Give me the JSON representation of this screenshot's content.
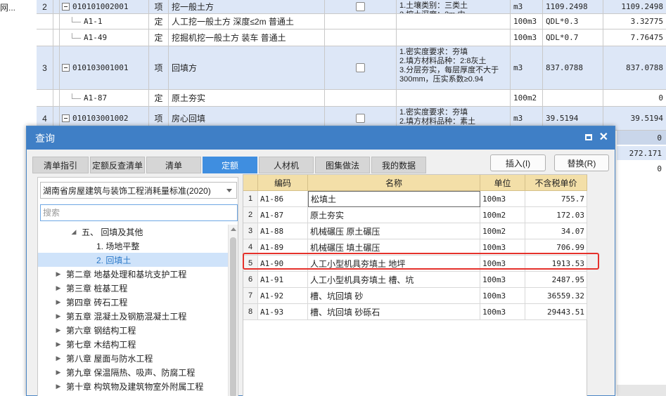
{
  "background": {
    "left_text": "网...",
    "rows": [
      {
        "idx": "2",
        "code": "010101002001",
        "type": "项",
        "name": "挖一般土方",
        "desc": "1.土壤类别：三类土\n2.挖土深度：2m 内",
        "unit": "m3",
        "expr": "1109.2498",
        "value": "1109.2498",
        "style": "blue",
        "level": "parent"
      },
      {
        "idx": "",
        "code": "A1-1",
        "type": "定",
        "name": "人工挖一般土方 深度≤2m 普通土",
        "desc": "",
        "unit": "100m3",
        "expr": "QDL*0.3",
        "value": "3.32775",
        "style": "white",
        "level": "child"
      },
      {
        "idx": "",
        "code": "A1-49",
        "type": "定",
        "name": "挖掘机挖一般土方 装车 普通土",
        "desc": "",
        "unit": "100m3",
        "expr": "QDL*0.7",
        "value": "7.76475",
        "style": "white",
        "level": "child"
      },
      {
        "idx": "3",
        "code": "010103001001",
        "type": "项",
        "name": "回填方",
        "desc": "1.密实度要求：夯填\n2.填方材料品种：2:8灰土\n3.分层夯实，每层厚度不大于300mm，压实系数≥0.94",
        "unit": "m3",
        "expr": "837.0788",
        "value": "837.0788",
        "style": "blue",
        "level": "parent"
      },
      {
        "idx": "",
        "code": "A1-87",
        "type": "定",
        "name": "原土夯实",
        "desc": "",
        "unit": "100m2",
        "expr": "",
        "value": "0",
        "style": "white",
        "level": "child"
      },
      {
        "idx": "4",
        "code": "010103001002",
        "type": "项",
        "name": "房心回填",
        "desc": "1.密实度要求：夯填\n2.填方材料品种：素土",
        "unit": "m3",
        "expr": "39.5194",
        "value": "39.5194",
        "style": "blue",
        "level": "parent"
      }
    ],
    "strip_values": [
      "0",
      "272.171",
      "0"
    ]
  },
  "dialog": {
    "title": "查询",
    "tabs": [
      "清单指引",
      "定额反查清单",
      "清单",
      "定额",
      "人材机",
      "图集做法",
      "我的数据"
    ],
    "active_tab": "定额",
    "insert_label": "插入(I)",
    "replace_label": "替换(R)",
    "standard_select": "湖南省房屋建筑与装饰工程消耗量标准(2020)",
    "search_placeholder": "搜索",
    "tree": [
      {
        "label": "五、 回填及其他",
        "indent": 46,
        "tri": "◢",
        "selected": false
      },
      {
        "label": "1. 场地平整",
        "indent": 83,
        "tri": "",
        "selected": false
      },
      {
        "label": "2. 回填土",
        "indent": 83,
        "tri": "",
        "selected": true
      },
      {
        "label": "第二章 地基处理和基坑支护工程",
        "indent": 24,
        "tri": "▶",
        "selected": false
      },
      {
        "label": "第三章 桩基工程",
        "indent": 24,
        "tri": "▶",
        "selected": false
      },
      {
        "label": "第四章 砖石工程",
        "indent": 24,
        "tri": "▶",
        "selected": false
      },
      {
        "label": "第五章 混凝土及钢筋混凝土工程",
        "indent": 24,
        "tri": "▶",
        "selected": false
      },
      {
        "label": "第六章 钢结构工程",
        "indent": 24,
        "tri": "▶",
        "selected": false
      },
      {
        "label": "第七章 木结构工程",
        "indent": 24,
        "tri": "▶",
        "selected": false
      },
      {
        "label": "第八章 屋面与防水工程",
        "indent": 24,
        "tri": "▶",
        "selected": false
      },
      {
        "label": "第九章 保温隔热、吸声、防腐工程",
        "indent": 24,
        "tri": "▶",
        "selected": false
      },
      {
        "label": "第十章 构筑物及建筑物室外附属工程",
        "indent": 24,
        "tri": "▶",
        "selected": false
      },
      {
        "label": "第十一章 楼地面工程",
        "indent": 24,
        "tri": "▶",
        "selected": false
      }
    ],
    "grid": {
      "headers": {
        "code": "编码",
        "name": "名称",
        "unit": "单位",
        "price": "不含税单价"
      },
      "rows": [
        {
          "n": "1",
          "code": "A1-86",
          "name": "松填土",
          "unit": "100m3",
          "price": "755.7"
        },
        {
          "n": "2",
          "code": "A1-87",
          "name": "原土夯实",
          "unit": "100m2",
          "price": "172.03"
        },
        {
          "n": "3",
          "code": "A1-88",
          "name": "机械碾压 原土碾压",
          "unit": "100m2",
          "price": "34.07"
        },
        {
          "n": "4",
          "code": "A1-89",
          "name": "机械碾压 填土碾压",
          "unit": "100m3",
          "price": "706.99"
        },
        {
          "n": "5",
          "code": "A1-90",
          "name": "人工小型机具夯填土 地坪",
          "unit": "100m3",
          "price": "1913.53"
        },
        {
          "n": "6",
          "code": "A1-91",
          "name": "人工小型机具夯填土 槽、坑",
          "unit": "100m3",
          "price": "2487.95"
        },
        {
          "n": "7",
          "code": "A1-92",
          "name": "槽、坑回填 砂",
          "unit": "100m3",
          "price": "36559.32"
        },
        {
          "n": "8",
          "code": "A1-93",
          "name": "槽、坑回填 砂砾石",
          "unit": "100m3",
          "price": "29443.51"
        }
      ]
    }
  },
  "colors": {
    "accent": "#3f7fc6",
    "highlight": "#e5312b",
    "row_blue": "#dde7f7",
    "header": "#f3dfa8"
  }
}
